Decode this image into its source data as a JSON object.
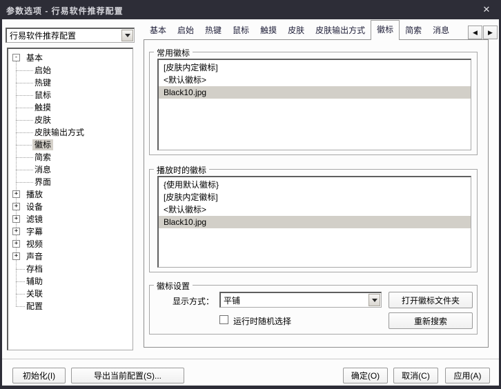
{
  "window": {
    "title": "参数选项 - 行易软件推荐配置",
    "close_icon": "✕"
  },
  "config_select": {
    "value": "行易软件推荐配置"
  },
  "tabs": {
    "items": [
      {
        "label": "基本",
        "selected": false
      },
      {
        "label": "启始",
        "selected": false
      },
      {
        "label": "热键",
        "selected": false
      },
      {
        "label": "鼠标",
        "selected": false
      },
      {
        "label": "触摸",
        "selected": false
      },
      {
        "label": "皮肤",
        "selected": false
      },
      {
        "label": "皮肤输出方式",
        "selected": false
      },
      {
        "label": "徽标",
        "selected": true
      },
      {
        "label": "简索",
        "selected": false
      },
      {
        "label": "消息",
        "selected": false
      }
    ],
    "scroll_left": "◀",
    "scroll_right": "▶"
  },
  "tree": {
    "items": [
      {
        "label": "基本",
        "level": 0,
        "expander": "minus",
        "selected": false
      },
      {
        "label": "启始",
        "level": 1,
        "expander": null,
        "selected": false
      },
      {
        "label": "热键",
        "level": 1,
        "expander": null,
        "selected": false
      },
      {
        "label": "鼠标",
        "level": 1,
        "expander": null,
        "selected": false
      },
      {
        "label": "触摸",
        "level": 1,
        "expander": null,
        "selected": false
      },
      {
        "label": "皮肤",
        "level": 1,
        "expander": null,
        "selected": false
      },
      {
        "label": "皮肤输出方式",
        "level": 1,
        "expander": null,
        "selected": false
      },
      {
        "label": "徽标",
        "level": 1,
        "expander": null,
        "selected": true
      },
      {
        "label": "简索",
        "level": 1,
        "expander": null,
        "selected": false
      },
      {
        "label": "消息",
        "level": 1,
        "expander": null,
        "selected": false
      },
      {
        "label": "界面",
        "level": 1,
        "expander": null,
        "selected": false
      },
      {
        "label": "播放",
        "level": 0,
        "expander": "plus",
        "selected": false
      },
      {
        "label": "设备",
        "level": 0,
        "expander": "plus",
        "selected": false
      },
      {
        "label": "滤镜",
        "level": 0,
        "expander": "plus",
        "selected": false
      },
      {
        "label": "字幕",
        "level": 0,
        "expander": "plus",
        "selected": false
      },
      {
        "label": "视频",
        "level": 0,
        "expander": "plus",
        "selected": false
      },
      {
        "label": "声音",
        "level": 0,
        "expander": "plus",
        "selected": false
      },
      {
        "label": "存档",
        "level": 0,
        "expander": null,
        "selected": false
      },
      {
        "label": "辅助",
        "level": 0,
        "expander": null,
        "selected": false
      },
      {
        "label": "关联",
        "level": 0,
        "expander": null,
        "selected": false
      },
      {
        "label": "配置",
        "level": 0,
        "expander": null,
        "selected": false
      }
    ]
  },
  "groups": {
    "common_logos": {
      "title": "常用徽标",
      "items": [
        {
          "label": "[皮肤内定徽标]",
          "selected": false
        },
        {
          "label": "<默认徽标>",
          "selected": false
        },
        {
          "label": "Black10.jpg",
          "selected": true
        }
      ]
    },
    "playback_logos": {
      "title": "播放时的徽标",
      "items": [
        {
          "label": "{使用默认徽标}",
          "selected": false
        },
        {
          "label": "[皮肤内定徽标]",
          "selected": false
        },
        {
          "label": "<默认徽标>",
          "selected": false
        },
        {
          "label": "Black10.jpg",
          "selected": true
        }
      ]
    },
    "logo_settings": {
      "title": "徽标设置",
      "display_mode_label": "显示方式：",
      "display_mode_value": "平铺",
      "open_folder_button": "打开徽标文件夹",
      "research_button": "重新搜索",
      "random_checkbox_label": "运行时随机选择",
      "random_checked": false
    }
  },
  "footer": {
    "init_button": "初始化(I)",
    "export_button": "导出当前配置(S)...",
    "ok_button": "确定(O)",
    "cancel_button": "取消(C)",
    "apply_button": "应用(A)"
  },
  "colors": {
    "title_bar": "#2d2d37",
    "title_text": "#d4d4da",
    "client_bg": "#fcfcfc",
    "selection_bg": "#d2cfc8",
    "tab_text": "#1e1e38"
  }
}
